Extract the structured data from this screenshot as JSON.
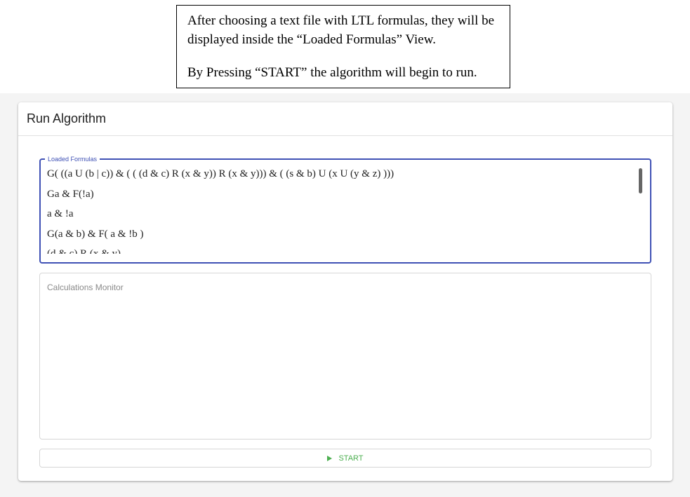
{
  "annotation": {
    "paragraph1": "After choosing a text file with LTL formulas, they will be displayed inside the “Loaded Formulas” View.",
    "paragraph2": "By Pressing “START” the algorithm will begin to run."
  },
  "card": {
    "title": "Run Algorithm"
  },
  "loaded_formulas": {
    "label": "Loaded Formulas",
    "items": [
      "G( ((a U (b | c)) & ( ( (d & c) R (x & y)) R (x & y))) & ( (s & b) U (x U (y & z) )))",
      "Ga & F(!a)",
      "a & !a",
      "G(a & b) & F( a & !b )",
      "(d & c) R (x & y)"
    ]
  },
  "monitor": {
    "placeholder": "Calculations Monitor"
  },
  "start_button": {
    "icon": "play-icon",
    "label": "START"
  },
  "colors": {
    "accent": "#3f51b5",
    "start": "#4caf50"
  }
}
